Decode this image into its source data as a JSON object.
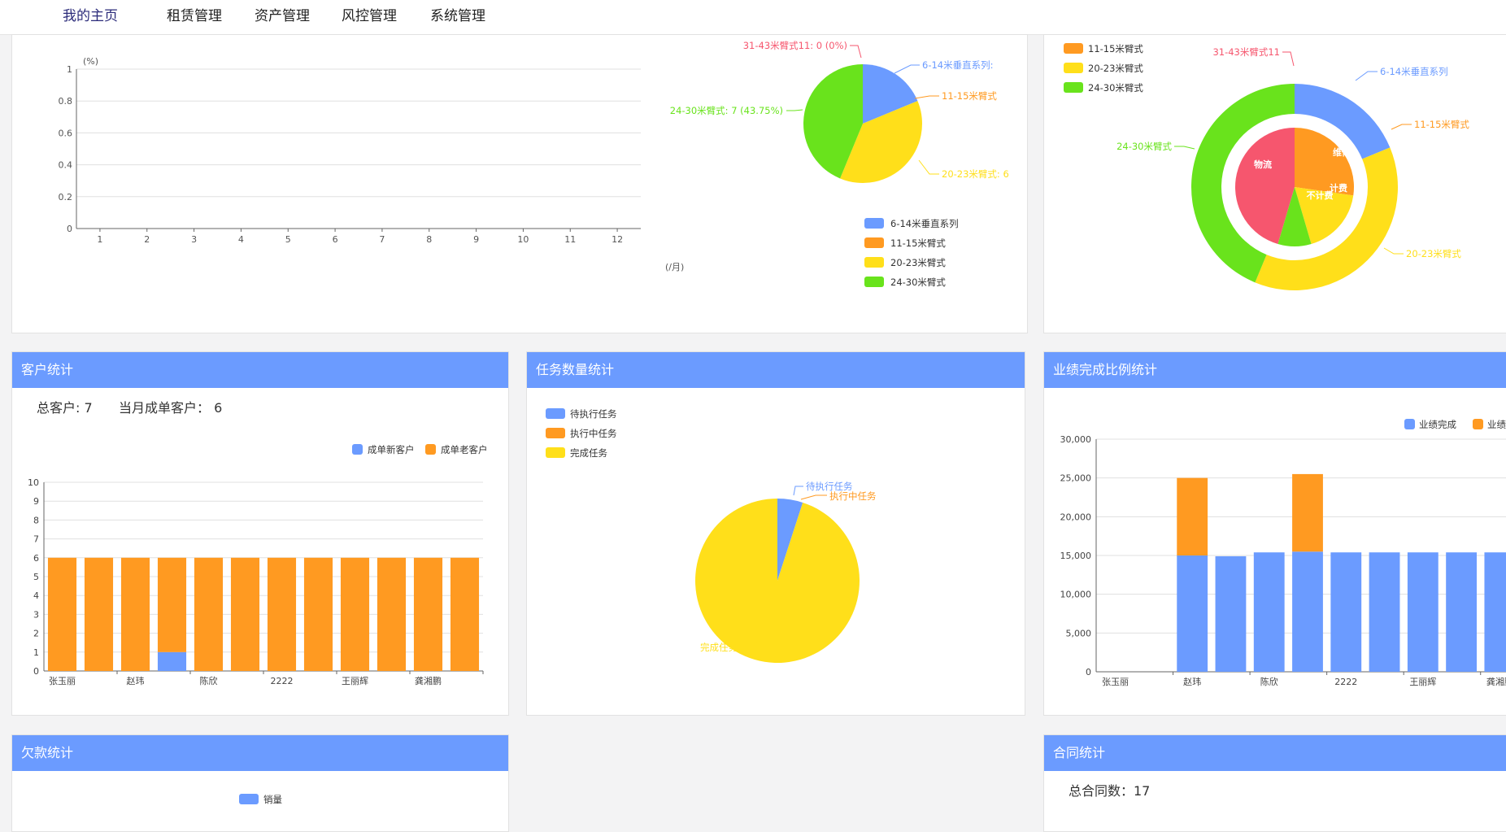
{
  "nav": {
    "items": [
      {
        "label": "我的主页",
        "active": true
      },
      {
        "label": "租赁管理"
      },
      {
        "label": "资产管理"
      },
      {
        "label": "风控管理"
      },
      {
        "label": "系统管理"
      }
    ]
  },
  "colors": {
    "blue": "#6b9bff",
    "orange": "#ff9a21",
    "yellow": "#ffdf1a",
    "green": "#69e31c",
    "red": "#f6566e"
  },
  "trend_chart": {
    "y_unit": "(%)",
    "x_unit": "(/月)",
    "y_ticks": [
      "0",
      "0.2",
      "0.4",
      "0.6",
      "0.8",
      "1"
    ],
    "x_ticks": [
      "1",
      "2",
      "3",
      "4",
      "5",
      "6",
      "7",
      "8",
      "9",
      "10",
      "11",
      "12"
    ]
  },
  "type_pie": {
    "labels": {
      "red": "31-43米臂式11: 0 (0%)",
      "blue": "6-14米垂直系列:",
      "orange": "11-15米臂式",
      "yellow": "20-23米臂式: 6",
      "green": "24-30米臂式: 7 (43.75%)"
    },
    "legend": [
      "6-14米垂直系列",
      "11-15米臂式",
      "20-23米臂式",
      "24-30米臂式"
    ]
  },
  "status_donut": {
    "legend": [
      "11-15米臂式",
      "20-23米臂式",
      "24-30米臂式"
    ],
    "labels": {
      "red": "31-43米臂式11",
      "blue": "6-14米垂直系列",
      "orange": "11-15米臂式",
      "green": "24-30米臂式",
      "yellow": "20-23米臂式"
    },
    "inner_labels": {
      "weixiu": "维修",
      "wuliu": "物流",
      "jifei": "计费",
      "bujifei": "不计费"
    }
  },
  "customer_panel": {
    "title": "客户统计",
    "total_label": "总客户: 7",
    "month_label": "当月成单客户： 6",
    "legend": [
      "成单新客户",
      "成单老客户"
    ]
  },
  "task_panel": {
    "title": "任务数量统计",
    "legend": [
      "待执行任务",
      "执行中任务",
      "完成任务"
    ],
    "labels": {
      "pending": "待执行任务",
      "running": "执行中任务",
      "done": "完成任务"
    }
  },
  "perf_panel": {
    "title": "业绩完成比例统计",
    "legend": [
      "业绩完成",
      "业绩"
    ]
  },
  "debt_panel": {
    "title": "欠款统计",
    "legend": [
      "销量"
    ]
  },
  "contract_panel": {
    "title": "合同统计",
    "total_label": "总合同数：17"
  },
  "chart_data": [
    {
      "type": "line",
      "title": "",
      "xlabel": "(/月)",
      "ylabel": "(%)",
      "x": [
        1,
        2,
        3,
        4,
        5,
        6,
        7,
        8,
        9,
        10,
        11,
        12
      ],
      "series": [],
      "ylim": [
        0,
        1
      ]
    },
    {
      "type": "pie",
      "categories": [
        "31-43米臂式11",
        "6-14米垂直系列",
        "11-15米臂式",
        "20-23米臂式",
        "24-30米臂式"
      ],
      "values": [
        0,
        3,
        0,
        6,
        7
      ]
    },
    {
      "type": "pie",
      "categories": [
        "31-43米臂式11",
        "6-14米垂直系列",
        "11-15米臂式",
        "20-23米臂式",
        "24-30米臂式"
      ],
      "values": [
        0,
        3,
        0,
        6,
        7
      ],
      "inner": {
        "categories": [
          "维修",
          "计费",
          "不计费",
          "物流"
        ],
        "values": [
          3,
          2,
          1,
          5
        ]
      }
    },
    {
      "type": "bar",
      "stacked": true,
      "categories": [
        "张玉丽",
        "",
        "赵玮",
        "",
        "陈欣",
        "",
        "2222",
        "",
        "王丽辉",
        "",
        "龚湘鹏",
        ""
      ],
      "series": [
        {
          "name": "成单新客户",
          "values": [
            0,
            0,
            0,
            1,
            0,
            0,
            0,
            0,
            0,
            0,
            0,
            0
          ]
        },
        {
          "name": "成单老客户",
          "values": [
            6,
            6,
            6,
            5,
            6,
            6,
            6,
            6,
            6,
            6,
            6,
            6
          ]
        }
      ],
      "ylim": [
        0,
        10
      ]
    },
    {
      "type": "pie",
      "categories": [
        "待执行任务",
        "执行中任务",
        "完成任务"
      ],
      "values": [
        5,
        0,
        95
      ]
    },
    {
      "type": "bar",
      "stacked": true,
      "categories": [
        "张玉丽",
        "",
        "赵玮",
        "",
        "陈欣",
        "",
        "2222",
        "",
        "王丽辉",
        "",
        "龚湘鹏"
      ],
      "series": [
        {
          "name": "业绩完成",
          "values": [
            0,
            0,
            15000,
            14900,
            15400,
            15500,
            15400,
            15400,
            15400,
            15400,
            15400
          ]
        },
        {
          "name": "业绩",
          "values": [
            0,
            0,
            10000,
            0,
            0,
            10000,
            0,
            0,
            0,
            0,
            0
          ]
        }
      ],
      "ylim": [
        0,
        30000
      ]
    }
  ]
}
